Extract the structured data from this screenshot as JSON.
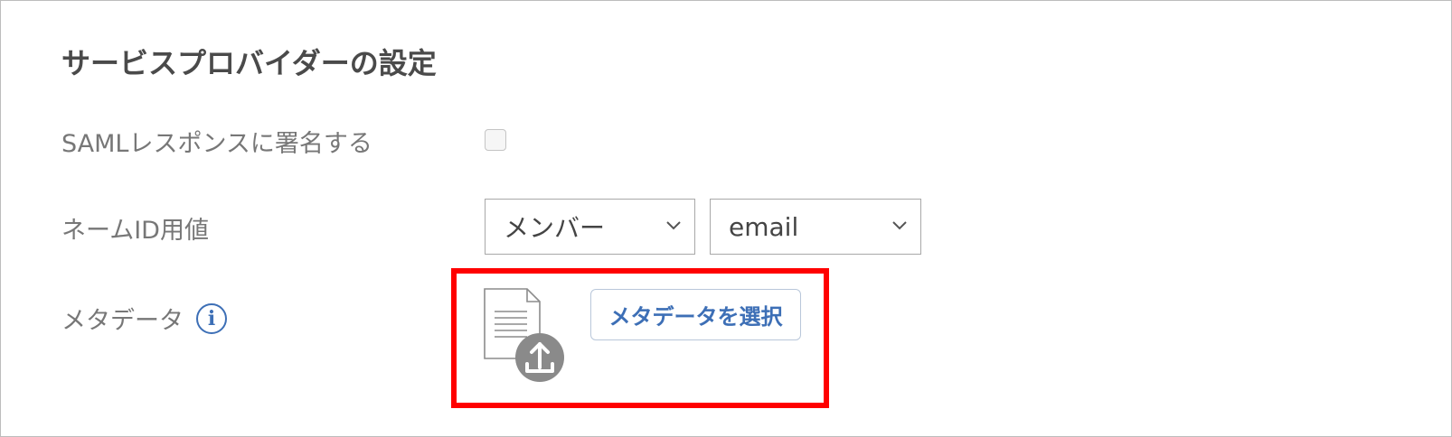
{
  "section": {
    "title": "サービスプロバイダーの設定"
  },
  "rows": {
    "saml_sign": {
      "label": "SAMLレスポンスに署名する",
      "checked": false
    },
    "name_id": {
      "label": "ネームID用値",
      "type_value": "メンバー",
      "field_value": "email"
    },
    "metadata": {
      "label": "メタデータ",
      "info_icon": "i",
      "button_label": "メタデータを選択"
    }
  },
  "colors": {
    "accent": "#3d6fb6",
    "highlight": "#ff0000",
    "upload_badge": "#8a8a8a"
  },
  "icons": {
    "info": "info-icon",
    "chevron": "chevron-down-icon",
    "file": "document-icon",
    "upload": "upload-icon"
  }
}
